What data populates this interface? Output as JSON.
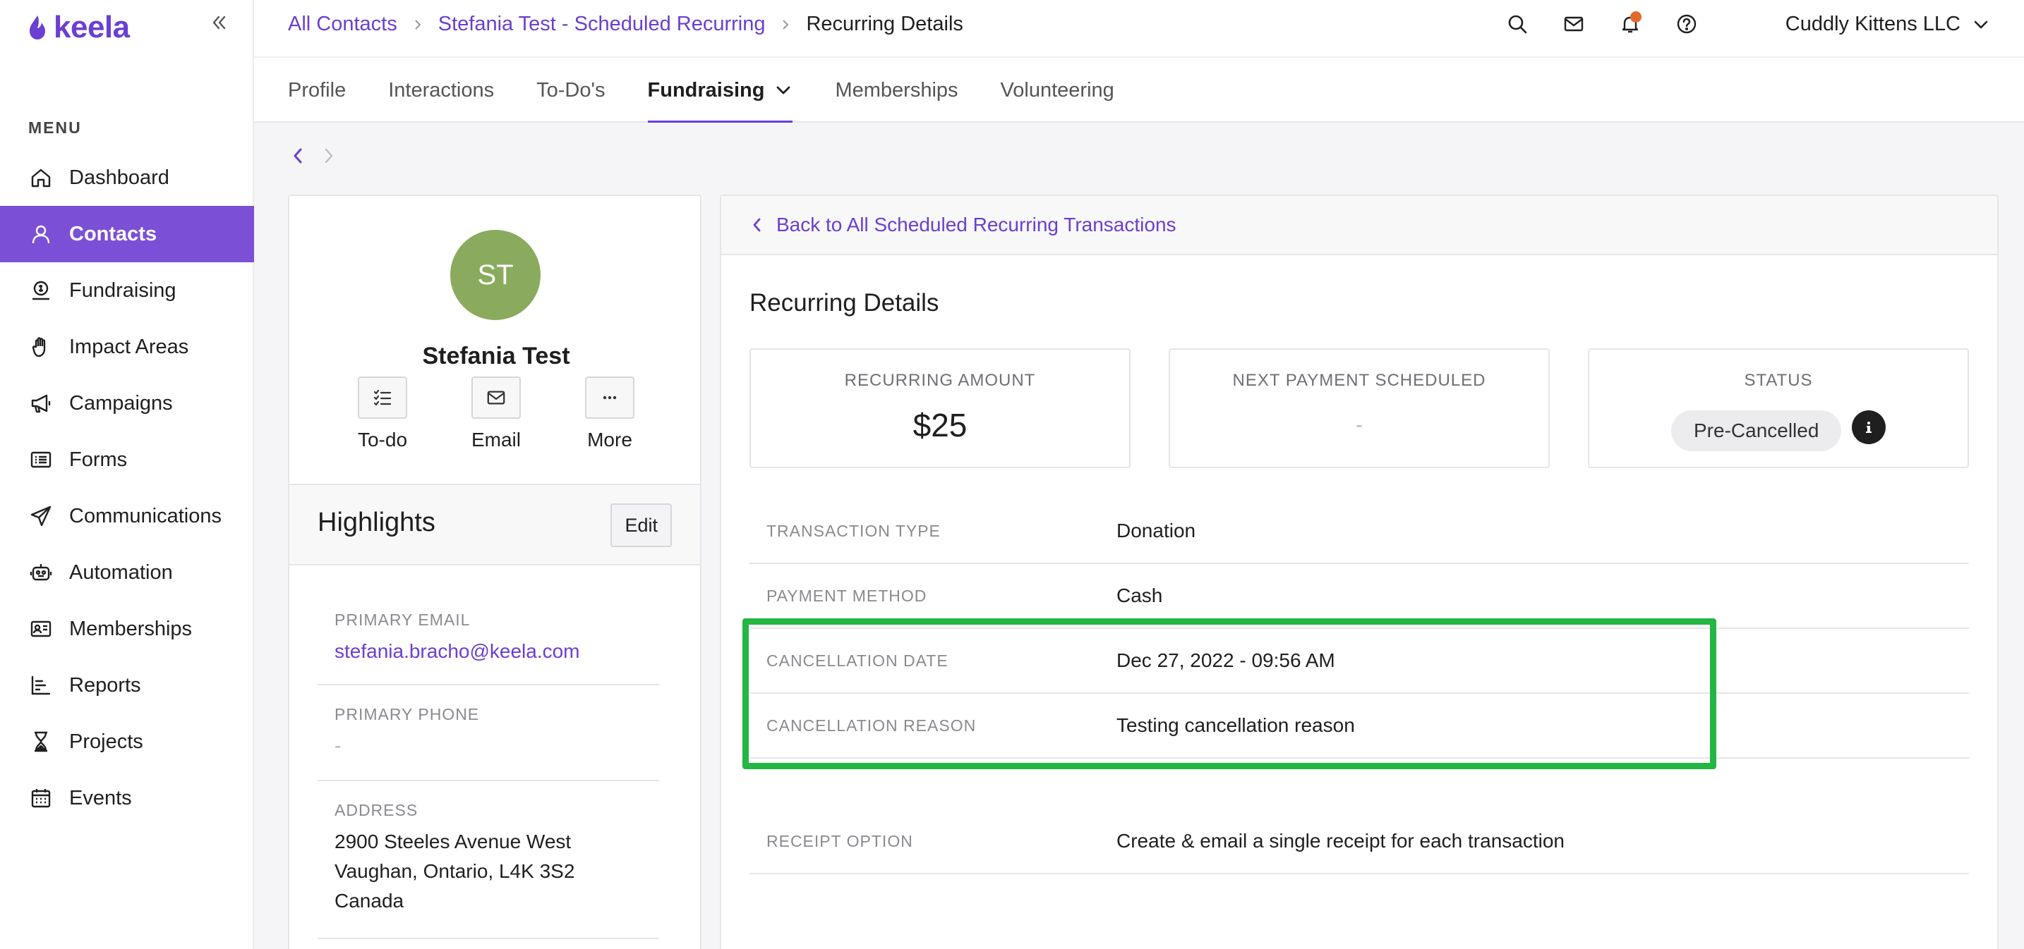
{
  "app": {
    "name": "keela"
  },
  "sidebar": {
    "menu_heading": "MENU",
    "items": [
      {
        "label": "Dashboard",
        "icon": "home-icon",
        "active": false
      },
      {
        "label": "Contacts",
        "icon": "person-icon",
        "active": true
      },
      {
        "label": "Fundraising",
        "icon": "donation-icon",
        "active": false
      },
      {
        "label": "Impact Areas",
        "icon": "hand-icon",
        "active": false
      },
      {
        "label": "Campaigns",
        "icon": "megaphone-icon",
        "active": false
      },
      {
        "label": "Forms",
        "icon": "form-icon",
        "active": false
      },
      {
        "label": "Communications",
        "icon": "paper-plane-icon",
        "active": false
      },
      {
        "label": "Automation",
        "icon": "robot-icon",
        "active": false
      },
      {
        "label": "Memberships",
        "icon": "id-card-icon",
        "active": false
      },
      {
        "label": "Reports",
        "icon": "bar-chart-icon",
        "active": false
      },
      {
        "label": "Projects",
        "icon": "hourglass-icon",
        "active": false
      },
      {
        "label": "Events",
        "icon": "calendar-icon",
        "active": false
      }
    ]
  },
  "breadcrumb": {
    "items": [
      "All Contacts",
      "Stefania Test - Scheduled Recurring"
    ],
    "current": "Recurring Details"
  },
  "header": {
    "org_name": "Cuddly Kittens LLC",
    "notification_color": "#e2692e"
  },
  "tabs": [
    {
      "label": "Profile",
      "active": false
    },
    {
      "label": "Interactions",
      "active": false
    },
    {
      "label": "To-Do's",
      "active": false
    },
    {
      "label": "Fundraising",
      "active": true,
      "has_dropdown": true
    },
    {
      "label": "Memberships",
      "active": false
    },
    {
      "label": "Volunteering",
      "active": false
    }
  ],
  "contact": {
    "initials": "ST",
    "avatar_color": "#8aab5e",
    "name": "Stefania Test",
    "actions": [
      "To-do",
      "Email",
      "More"
    ],
    "highlights_title": "Highlights",
    "edit_label": "Edit",
    "fields": [
      {
        "label": "PRIMARY EMAIL",
        "value": "stefania.bracho@keela.com"
      },
      {
        "label": "PRIMARY PHONE",
        "value": "-"
      },
      {
        "label": "ADDRESS",
        "lines": [
          "2900 Steeles Avenue West",
          "Vaughan, Ontario, L4K 3S2",
          "Canada"
        ]
      }
    ]
  },
  "recurring": {
    "back_label": "Back to All Scheduled Recurring Transactions",
    "title": "Recurring Details",
    "stats": [
      {
        "label": "RECURRING AMOUNT",
        "value": "$25"
      },
      {
        "label": "NEXT PAYMENT SCHEDULED",
        "value": "-"
      },
      {
        "label": "STATUS",
        "value": "Pre-Cancelled"
      }
    ],
    "details": [
      {
        "label": "TRANSACTION TYPE",
        "value": "Donation"
      },
      {
        "label": "PAYMENT METHOD",
        "value": "Cash"
      },
      {
        "label": "CANCELLATION DATE",
        "value": "Dec 27, 2022 - 09:56 AM"
      },
      {
        "label": "CANCELLATION REASON",
        "value": "Testing cancellation reason"
      },
      {
        "label": "RECEIPT OPTION",
        "value": "Create & email a single receipt for each transaction"
      }
    ],
    "highlight_color": "#23b642"
  },
  "colors": {
    "accent": "#6a3fd1",
    "active_nav": "#7b4fd6"
  }
}
